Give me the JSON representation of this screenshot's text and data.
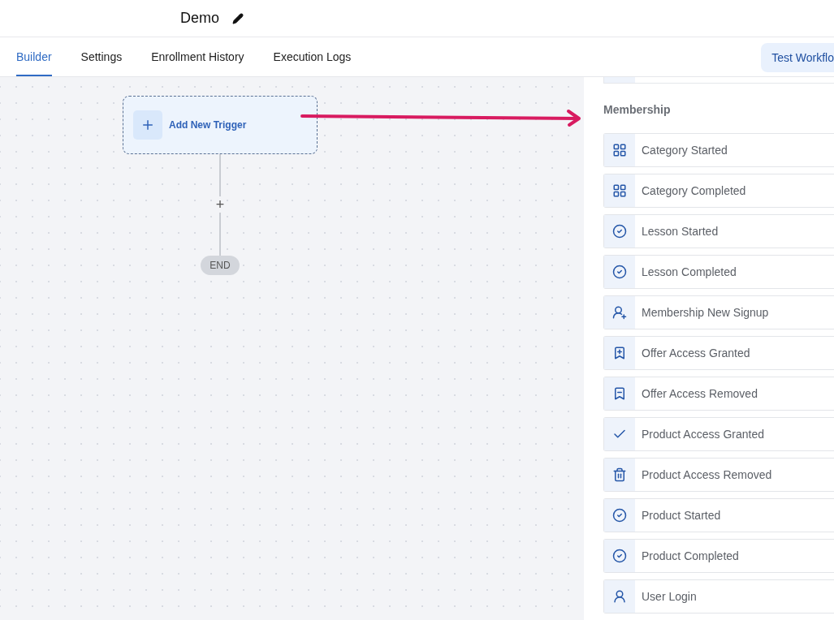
{
  "header": {
    "title": "Demo"
  },
  "tabs": [
    {
      "label": "Builder",
      "selected": true
    },
    {
      "label": "Settings",
      "selected": false
    },
    {
      "label": "Enrollment History",
      "selected": false
    },
    {
      "label": "Execution Logs",
      "selected": false
    }
  ],
  "test_button": "Test Workflo",
  "canvas": {
    "trigger": {
      "label": "Add New Trigger"
    },
    "add_step": "+",
    "end": "END"
  },
  "panel": {
    "section": "Membership",
    "items": [
      {
        "label": "Category Started",
        "kind": "grid"
      },
      {
        "label": "Category Completed",
        "kind": "grid"
      },
      {
        "label": "Lesson Started",
        "kind": "circle-check"
      },
      {
        "label": "Lesson Completed",
        "kind": "circle-check"
      },
      {
        "label": "Membership New Signup",
        "kind": "user-plus"
      },
      {
        "label": "Offer Access Granted",
        "kind": "bookmark-plus"
      },
      {
        "label": "Offer Access Removed",
        "kind": "bookmark-minus"
      },
      {
        "label": "Product Access Granted",
        "kind": "check"
      },
      {
        "label": "Product Access Removed",
        "kind": "trash"
      },
      {
        "label": "Product Started",
        "kind": "circle-check"
      },
      {
        "label": "Product Completed",
        "kind": "circle-check"
      },
      {
        "label": "User Login",
        "kind": "user"
      }
    ]
  }
}
